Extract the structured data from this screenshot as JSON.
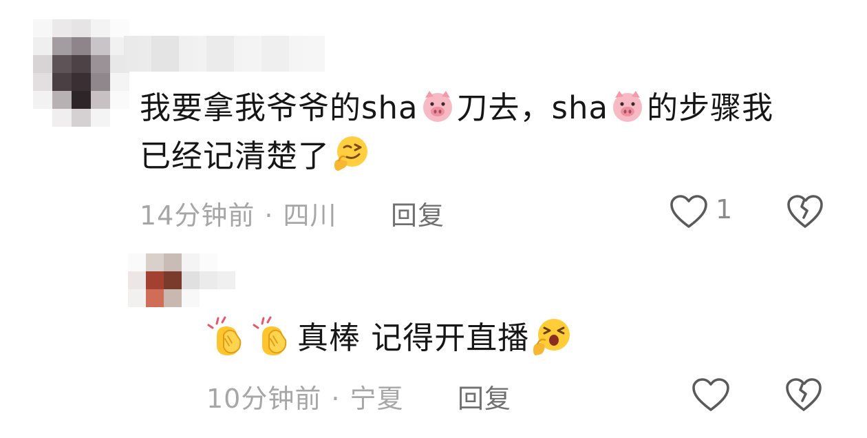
{
  "comments": [
    {
      "text_line1_a": "我要拿我爷爷的sha",
      "text_line1_b": "刀去，sha",
      "text_line1_c": "的步骤我",
      "text_line2": "已经记清楚了",
      "time": "14分钟前",
      "location": "四川",
      "reply_label": "回复",
      "like_count": "1"
    },
    {
      "text_a": "真棒 记得开直播",
      "time": "10分钟前",
      "location": "宁夏",
      "reply_label": "回复",
      "like_count": ""
    }
  ],
  "separator": "·",
  "icons": {
    "pig": "pig-face-emoji",
    "thinking": "smirk-thinking-emoji",
    "clap": "clapping-hands-emoji",
    "excited": "excited-face-emoji",
    "like": "heart-outline-icon",
    "dislike": "broken-heart-outline-icon"
  },
  "colors": {
    "text": "#161616",
    "meta": "#a6a6a6",
    "reply": "#707070",
    "icon_stroke": "#5a5a5a"
  }
}
